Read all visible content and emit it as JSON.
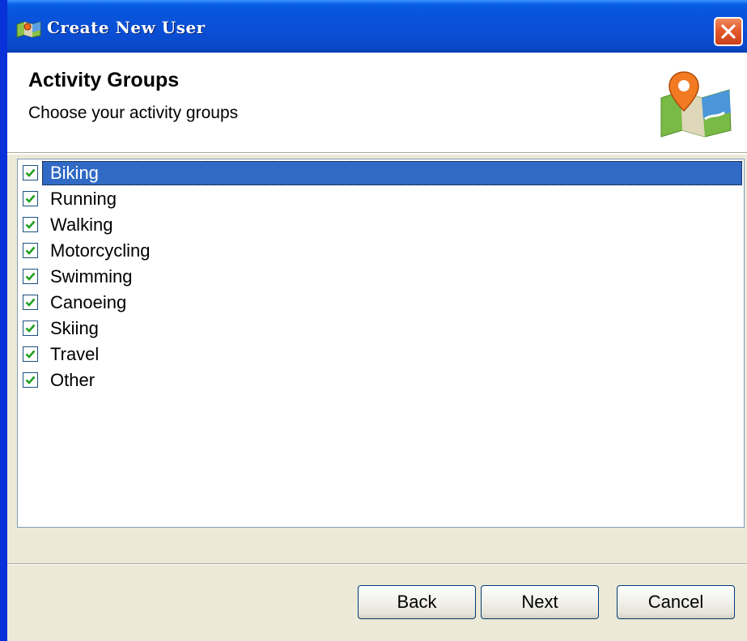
{
  "window": {
    "title": "Create New User",
    "title_icon": "map-app-icon",
    "close_icon": "close-icon"
  },
  "header": {
    "title": "Activity Groups",
    "subtitle": "Choose your activity groups",
    "graphic": "map-pin-icon"
  },
  "activity_list": {
    "selected_index": 0,
    "items": [
      {
        "label": "Biking",
        "checked": true
      },
      {
        "label": "Running",
        "checked": true
      },
      {
        "label": "Walking",
        "checked": true
      },
      {
        "label": "Motorcycling",
        "checked": true
      },
      {
        "label": "Swimming",
        "checked": true
      },
      {
        "label": "Canoeing",
        "checked": true
      },
      {
        "label": "Skiing",
        "checked": true
      },
      {
        "label": "Travel",
        "checked": true
      },
      {
        "label": "Other",
        "checked": true
      }
    ]
  },
  "buttons": {
    "back_label": "Back",
    "next_label": "Next",
    "cancel_label": "Cancel"
  },
  "colors": {
    "titlebar": "#0a4fd6",
    "selection": "#316ac5",
    "checkmark": "#21a121",
    "dialog_face": "#ece9d8"
  }
}
